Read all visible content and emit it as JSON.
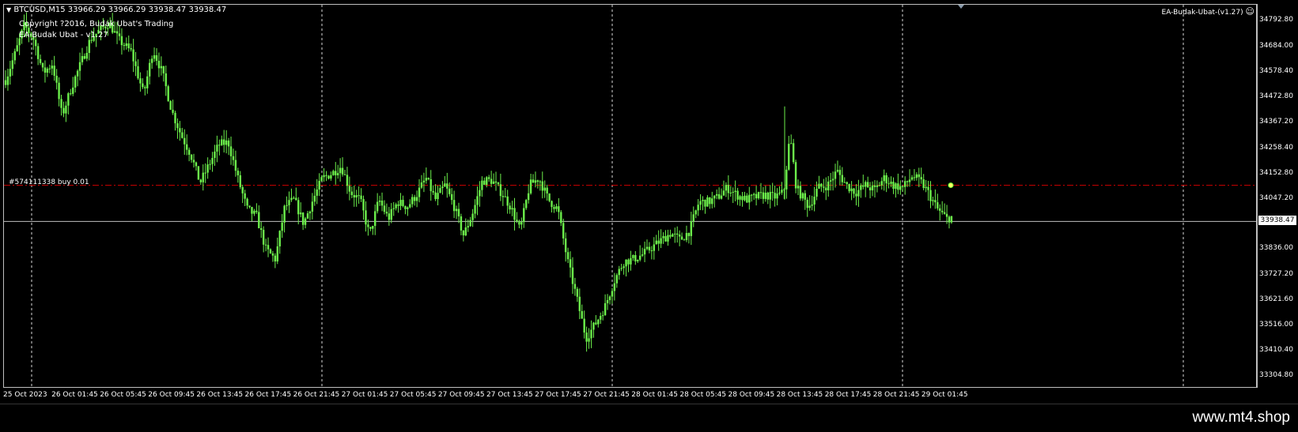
{
  "header": {
    "symbol_menu_icon": "triangle-down-icon",
    "symbol_info": "BTCUSD,M15  33966.29 33966.29 33938.47 33938.47",
    "copyright": "Copyright ?2016, Budak Ubat's Trading",
    "ea_version": "EA-Budak Ubat - v1.27",
    "ea_badge": "EA-Budak-Ubat-(v1.27)",
    "ea_status_icon": "smiley-icon"
  },
  "order_line": {
    "label": "#574111338 buy 0.01",
    "price": 34090,
    "color": "#d00000"
  },
  "current_price": {
    "value": 33938.47,
    "label": "33938.47",
    "line_color": "#c0c0c0"
  },
  "price_axis": {
    "labels": [
      "34792.80",
      "34684.00",
      "34578.40",
      "34472.80",
      "34367.20",
      "34258.40",
      "34152.80",
      "34047.20",
      "33836.00",
      "33727.20",
      "33621.60",
      "33516.00",
      "33410.40",
      "33304.80"
    ]
  },
  "time_axis": {
    "labels": [
      "25 Oct 2023",
      "26 Oct 01:45",
      "26 Oct 05:45",
      "26 Oct 09:45",
      "26 Oct 13:45",
      "26 Oct 17:45",
      "26 Oct 21:45",
      "27 Oct 01:45",
      "27 Oct 05:45",
      "27 Oct 09:45",
      "27 Oct 13:45",
      "27 Oct 17:45",
      "27 Oct 21:45",
      "28 Oct 01:45",
      "28 Oct 05:45",
      "28 Oct 09:45",
      "28 Oct 13:45",
      "28 Oct 17:45",
      "28 Oct 21:45",
      "29 Oct 01:45"
    ]
  },
  "colors": {
    "background": "#000000",
    "candle": "#6cf04b",
    "grid_dashed": "#ffffff"
  },
  "footer": {
    "url": "www.mt4.shop"
  },
  "chart_data": {
    "type": "candlestick",
    "symbol": "BTCUSD",
    "timeframe": "M15",
    "ylim": [
      33304.8,
      34846
    ],
    "close_path": [
      [
        0,
        34530
      ],
      [
        3,
        34640
      ],
      [
        6,
        34760
      ],
      [
        9,
        34700
      ],
      [
        12,
        34560
      ],
      [
        15,
        34600
      ],
      [
        18,
        34380
      ],
      [
        21,
        34500
      ],
      [
        24,
        34600
      ],
      [
        27,
        34700
      ],
      [
        30,
        34740
      ],
      [
        33,
        34770
      ],
      [
        36,
        34700
      ],
      [
        40,
        34650
      ],
      [
        44,
        34470
      ],
      [
        47,
        34660
      ],
      [
        50,
        34560
      ],
      [
        53,
        34400
      ],
      [
        56,
        34300
      ],
      [
        59,
        34220
      ],
      [
        62,
        34100
      ],
      [
        65,
        34180
      ],
      [
        68,
        34260
      ],
      [
        71,
        34270
      ],
      [
        74,
        34120
      ],
      [
        77,
        33990
      ],
      [
        80,
        33960
      ],
      [
        83,
        33820
      ],
      [
        86,
        33780
      ],
      [
        89,
        34000
      ],
      [
        92,
        34030
      ],
      [
        95,
        33930
      ],
      [
        98,
        34030
      ],
      [
        101,
        34120
      ],
      [
        104,
        34140
      ],
      [
        107,
        34170
      ],
      [
        110,
        34060
      ],
      [
        113,
        34030
      ],
      [
        116,
        33880
      ],
      [
        119,
        34030
      ],
      [
        122,
        33950
      ],
      [
        125,
        34020
      ],
      [
        128,
        34000
      ],
      [
        131,
        34050
      ],
      [
        134,
        34120
      ],
      [
        137,
        34030
      ],
      [
        140,
        34090
      ],
      [
        143,
        34000
      ],
      [
        146,
        33880
      ],
      [
        149,
        33980
      ],
      [
        152,
        34110
      ],
      [
        155,
        34110
      ],
      [
        158,
        34060
      ],
      [
        161,
        34000
      ],
      [
        164,
        33900
      ],
      [
        167,
        34090
      ],
      [
        170,
        34120
      ],
      [
        173,
        34030
      ],
      [
        176,
        33990
      ],
      [
        179,
        33780
      ],
      [
        182,
        33620
      ],
      [
        185,
        33450
      ],
      [
        188,
        33510
      ],
      [
        191,
        33580
      ],
      [
        194,
        33690
      ],
      [
        197,
        33770
      ],
      [
        200,
        33780
      ],
      [
        203,
        33800
      ],
      [
        206,
        33830
      ],
      [
        209,
        33860
      ],
      [
        212,
        33890
      ],
      [
        215,
        33860
      ],
      [
        218,
        33900
      ],
      [
        221,
        34020
      ],
      [
        224,
        34020
      ],
      [
        227,
        34040
      ],
      [
        230,
        34080
      ],
      [
        233,
        34050
      ],
      [
        236,
        34030
      ],
      [
        239,
        34040
      ],
      [
        242,
        34050
      ],
      [
        245,
        34040
      ],
      [
        248,
        34060
      ],
      [
        250,
        34300
      ],
      [
        252,
        34080
      ],
      [
        254,
        34040
      ],
      [
        256,
        34000
      ],
      [
        259,
        34080
      ],
      [
        262,
        34090
      ],
      [
        265,
        34150
      ],
      [
        268,
        34090
      ],
      [
        271,
        34060
      ],
      [
        274,
        34090
      ],
      [
        277,
        34070
      ],
      [
        280,
        34120
      ],
      [
        283,
        34090
      ],
      [
        286,
        34080
      ],
      [
        289,
        34130
      ],
      [
        292,
        34100
      ],
      [
        294,
        34060
      ],
      [
        297,
        33990
      ],
      [
        300,
        33950
      ],
      [
        302,
        33960
      ]
    ]
  }
}
